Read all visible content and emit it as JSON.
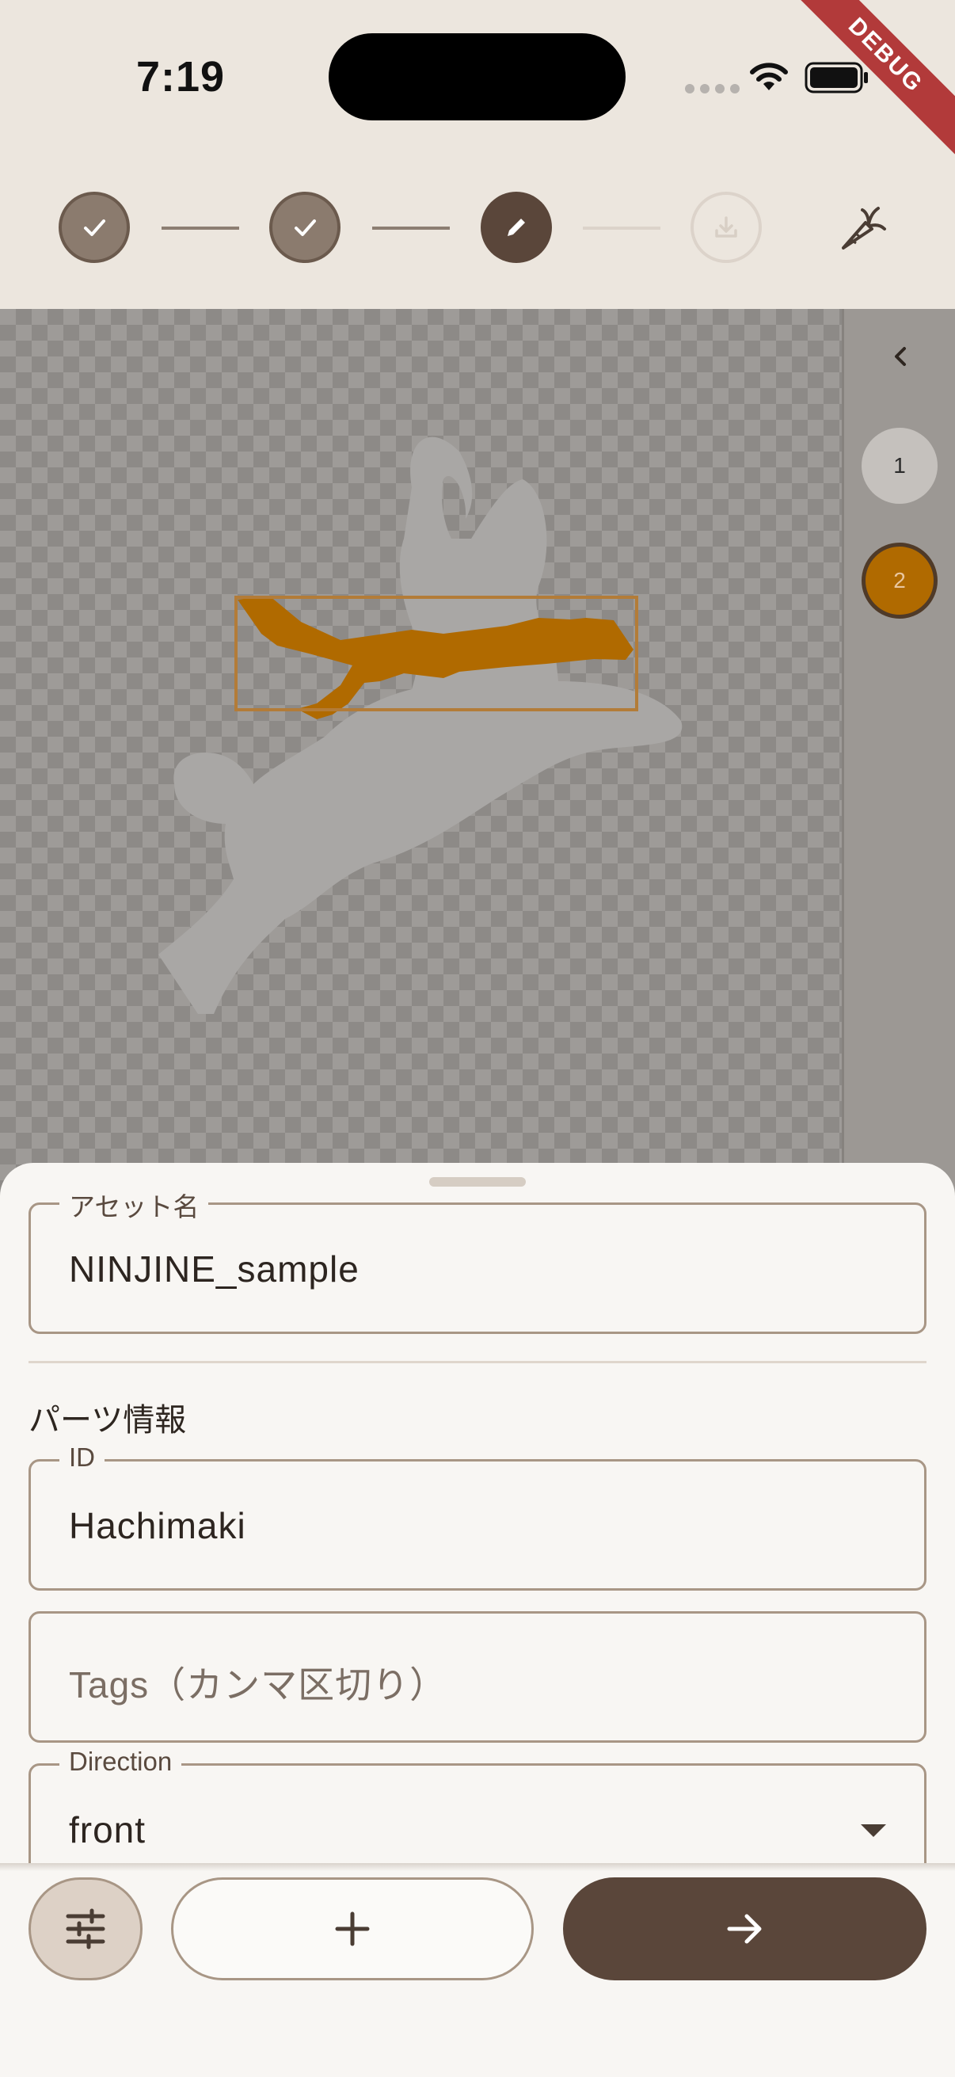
{
  "status_bar": {
    "time": "7:19",
    "debug_banner": "DEBUG"
  },
  "stepper": {
    "steps": [
      {
        "state": "done",
        "icon": "check-icon"
      },
      {
        "state": "done",
        "icon": "check-icon"
      },
      {
        "state": "current",
        "icon": "pencil-icon"
      },
      {
        "state": "todo",
        "icon": "download-icon"
      }
    ],
    "action_icon": "carrot-icon"
  },
  "layers": {
    "collapse_icon": "chevron-left-icon",
    "items": [
      {
        "label": "1",
        "selected": false
      },
      {
        "label": "2",
        "selected": true
      }
    ],
    "selected_color": "#b06a00"
  },
  "form": {
    "asset_name": {
      "label": "アセット名",
      "value": "NINJINE_sample"
    },
    "parts_section_title": "パーツ情報",
    "id_field": {
      "label": "ID",
      "value": "Hachimaki"
    },
    "tags_field": {
      "placeholder": "Tags（カンマ区切り）"
    },
    "direction_field": {
      "label": "Direction",
      "value": "front"
    }
  },
  "actions": {
    "settings_icon": "sliders-icon",
    "add_icon": "plus-icon",
    "next_icon": "arrow-right-icon"
  },
  "colors": {
    "accent": "#5a463a",
    "part_highlight": "#b06a00"
  }
}
